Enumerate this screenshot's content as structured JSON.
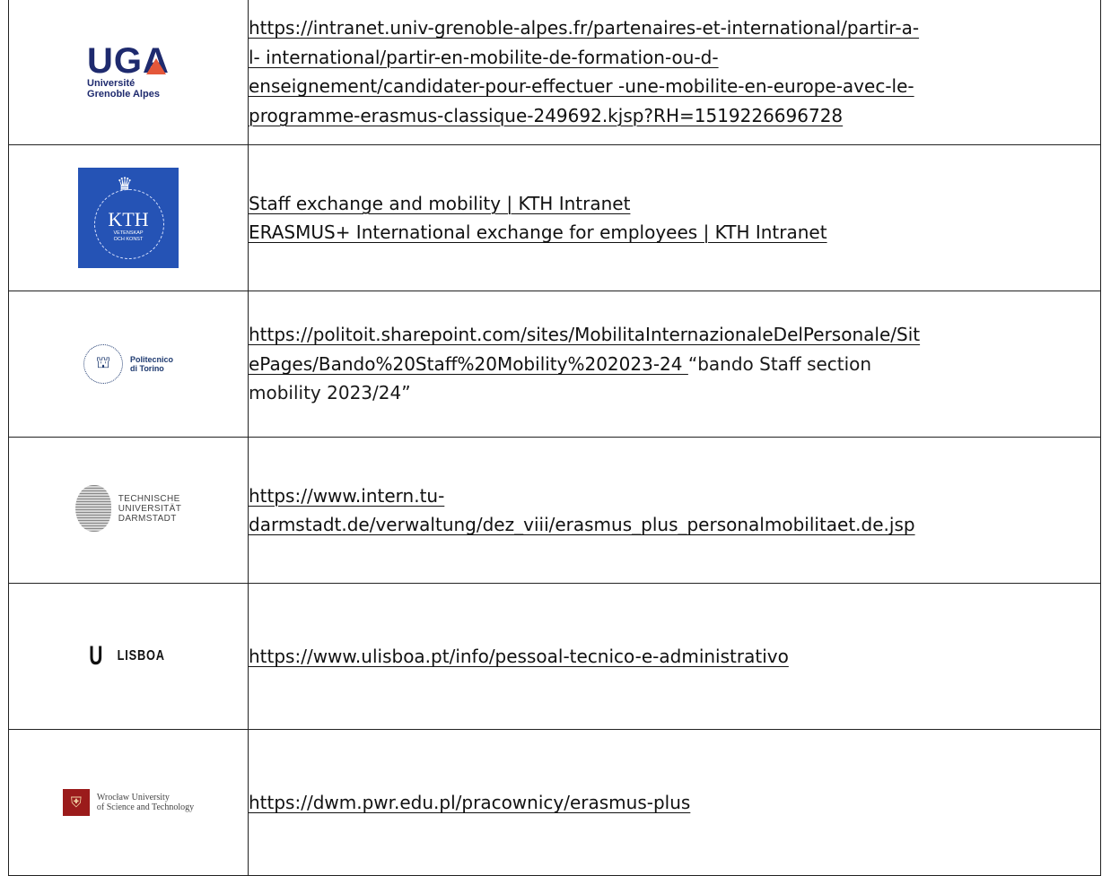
{
  "rows": [
    {
      "logo": {
        "icon": "uga-logo",
        "mark": "UGA",
        "line1": "Université",
        "line2": "Grenoble Alpes",
        "accent": "#e4573a",
        "color": "#1e2a6e"
      },
      "links": [
        "https://intranet.univ-grenoble-alpes.fr/partenaires-et-international/partir-a-",
        "l- international/partir-en-mobilite-de-formation-ou-d-",
        "enseignement/candidater-pour-effectuer -une-mobilite-en-europe-avec-le-",
        "programme-erasmus-classique-249692.kjsp?RH=1519226696728 "
      ]
    },
    {
      "logo": {
        "icon": "kth-logo",
        "name": "KTH",
        "line1": "VETENSKAP",
        "line2": "OCH KONST",
        "color": "#2553b5"
      },
      "links": [
        "Staff exchange and mobility | KTH Intranet ",
        "ERASMUS+ International exchange for employees | KTH Intranet "
      ]
    },
    {
      "logo": {
        "icon": "politecnico-torino-logo",
        "line1": "Politecnico",
        "line2": "di Torino"
      },
      "link_lines": [
        "https://politoit.sharepoint.com/sites/MobilitaInternazionaleDelPersonale/Sit",
        "ePages/Bando%20Staff%20Mobility%202023-24 "
      ],
      "tail": "“bando Staff section",
      "tail2": "mobility 2023/24”"
    },
    {
      "logo": {
        "icon": "tu-darmstadt-logo",
        "line1": "TECHNISCHE",
        "line2": "UNIVERSITÄT",
        "line3": "DARMSTADT"
      },
      "links": [
        "https://www.intern.tu-",
        "darmstadt.de/verwaltung/dez_viii/erasmus_plus_personalmobilitaet.de.jsp "
      ]
    },
    {
      "logo": {
        "icon": "ulisboa-logo",
        "mark": "U",
        "name": "LISBOA"
      },
      "links": [
        "https://www.ulisboa.pt/info/pessoal-tecnico-e-administrativo "
      ]
    },
    {
      "logo": {
        "icon": "wroclaw-university-logo",
        "line1": "Wrocław University",
        "line2": "of Science and Technology",
        "color": "#9b1b1b"
      },
      "links": [
        "https://dwm.pwr.edu.pl/pracownicy/erasmus-plus "
      ]
    }
  ]
}
